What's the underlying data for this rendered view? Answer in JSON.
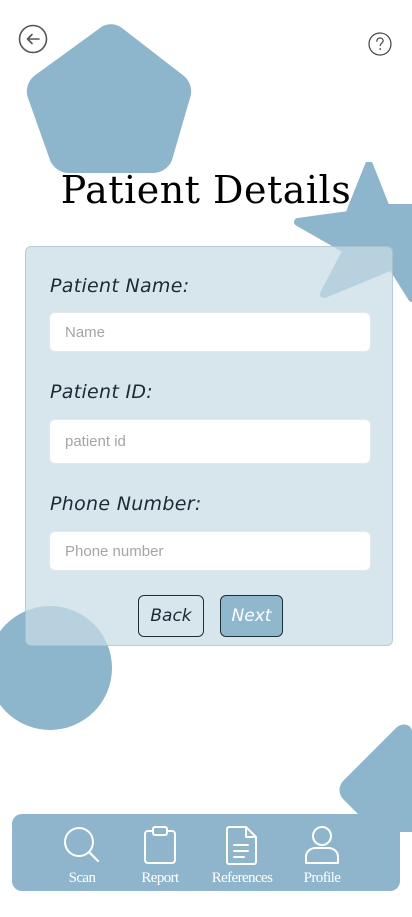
{
  "page": {
    "title": "Patient Details"
  },
  "header": {
    "back_icon": "arrow-left-circle-icon",
    "help_icon": "question-circle-icon"
  },
  "form": {
    "fields": [
      {
        "label": "Patient Name:",
        "placeholder": "Name",
        "value": ""
      },
      {
        "label": "Patient ID:",
        "placeholder": "patient id",
        "value": ""
      },
      {
        "label": "Phone Number:",
        "placeholder": "Phone number",
        "value": ""
      }
    ],
    "back_label": "Back",
    "next_label": "Next"
  },
  "nav": {
    "items": [
      {
        "label": "Scan",
        "icon": "search-icon"
      },
      {
        "label": "Report",
        "icon": "clipboard-icon"
      },
      {
        "label": "References",
        "icon": "document-icon"
      },
      {
        "label": "Profile",
        "icon": "user-icon"
      }
    ]
  },
  "colors": {
    "accent": "#8fb5cc",
    "card_background": "#d3e2ea",
    "decor_shape": "#8db6cd",
    "text": "#000000"
  }
}
